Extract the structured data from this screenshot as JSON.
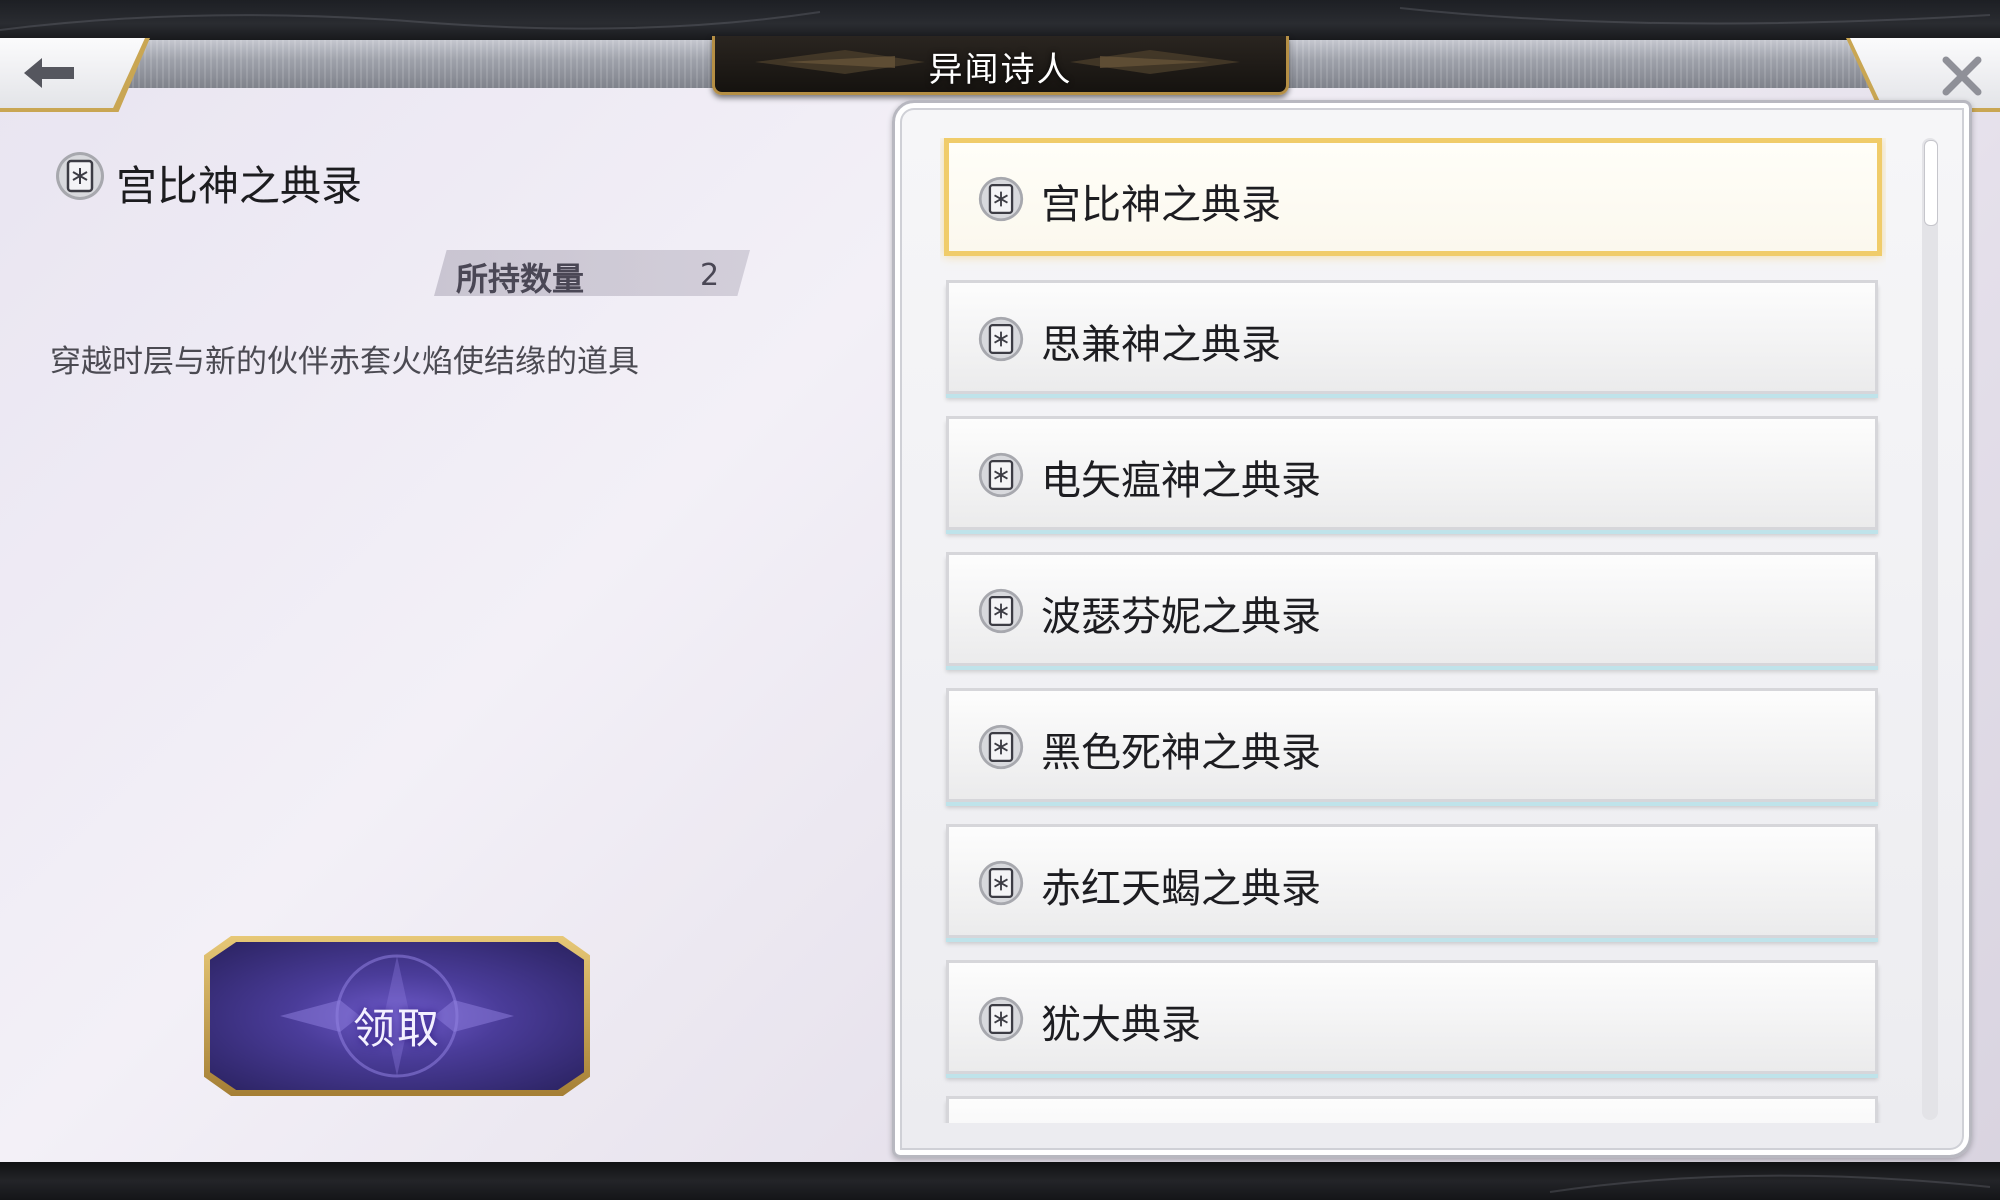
{
  "header": {
    "title": "异闻诗人"
  },
  "detail": {
    "item_name": "宫比神之典录",
    "count_label": "所持数量",
    "count_value": "2",
    "description": "穿越时层与新的伙伴赤套火焰使结缘的道具"
  },
  "claim_button": {
    "label": "领取"
  },
  "list": {
    "items": [
      {
        "label": "宫比神之典录",
        "selected": true
      },
      {
        "label": "思兼神之典录",
        "selected": false
      },
      {
        "label": "电矢瘟神之典录",
        "selected": false
      },
      {
        "label": "波瑟芬妮之典录",
        "selected": false
      },
      {
        "label": "黑色死神之典录",
        "selected": false
      },
      {
        "label": "赤红天蝎之典录",
        "selected": false
      },
      {
        "label": "犹大典录",
        "selected": false
      }
    ]
  },
  "scrollbar": {
    "position_fraction": 0.0
  },
  "colors": {
    "accent_gold": "#f0cc6a",
    "button_purple": "#4a3c99",
    "panel_bg": "#f6f6f8"
  },
  "icons": {
    "back": "arrow-left-icon",
    "close": "close-icon",
    "item": "book-icon"
  }
}
